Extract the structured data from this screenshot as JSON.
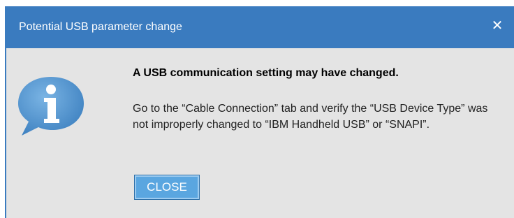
{
  "dialog": {
    "title": "Potential USB parameter change",
    "close_glyph": "✕",
    "heading": "A USB communication setting may have changed.",
    "message": "Go to the “Cable Connection” tab and verify the “USB Device Type” was not improperly changed to “IBM Handheld USB” or “SNAPI”.",
    "close_button_label": "CLOSE",
    "icon": "info-icon"
  },
  "colors": {
    "titlebar": "#3a7bbf",
    "background": "#e4e4e4",
    "button": "#5aa6e0",
    "icon_bubble": "#4d8fc9"
  }
}
